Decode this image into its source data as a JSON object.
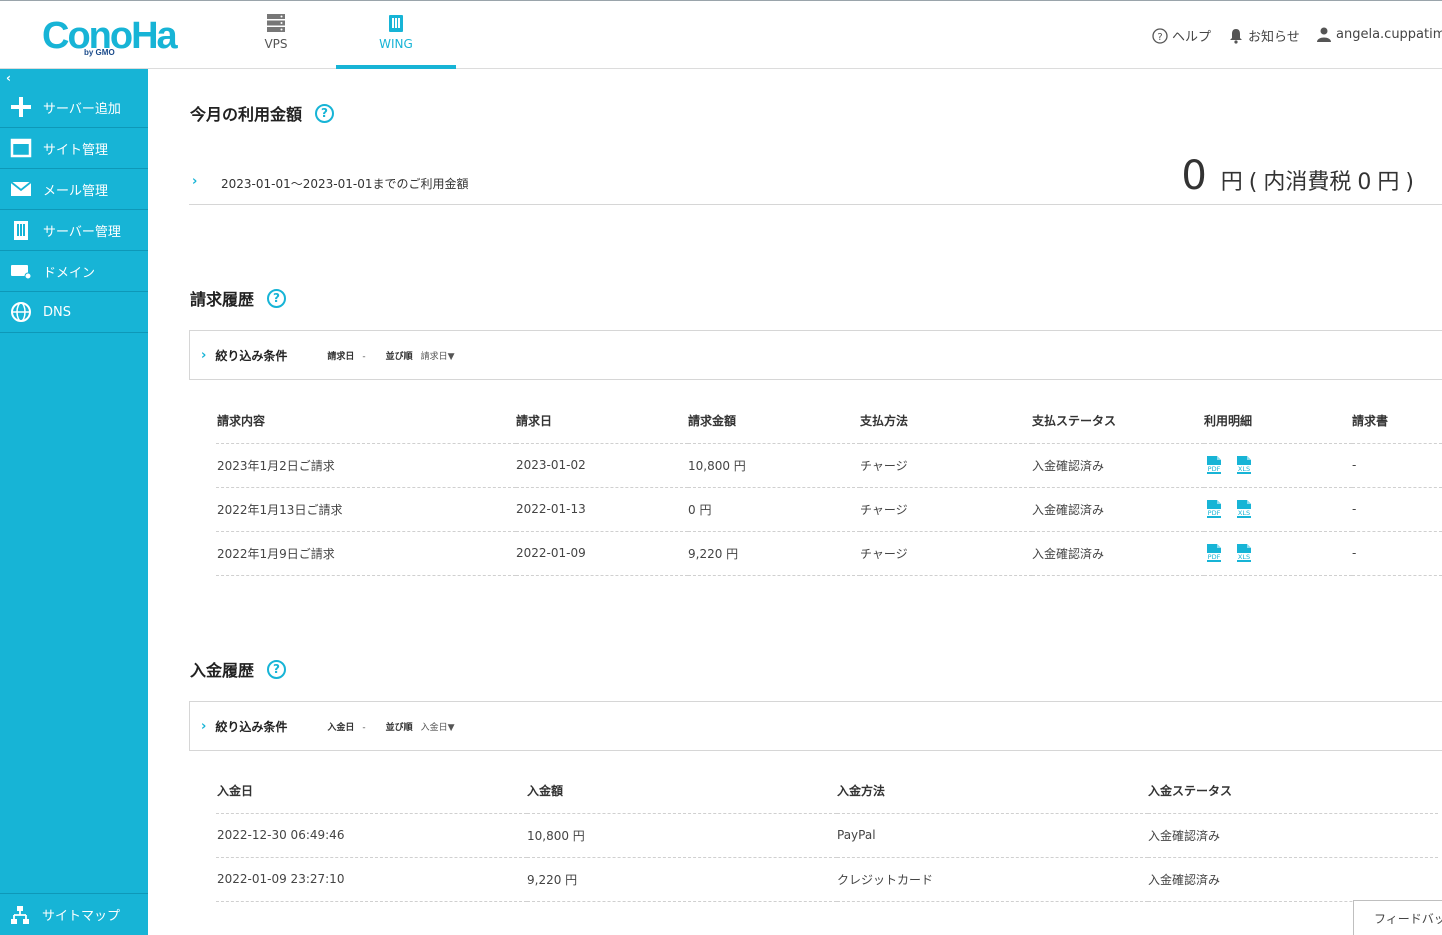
{
  "brand": {
    "logo_text": "ConoHa",
    "logo_sub": "by GMO"
  },
  "top_tabs": [
    {
      "label": "VPS",
      "icon": "server-icon"
    },
    {
      "label": "WING",
      "icon": "wing-building-icon",
      "active": true
    }
  ],
  "header_links": {
    "help": "ヘルプ",
    "notice": "お知らせ",
    "user": "angela.cuppatimes"
  },
  "sidebar": {
    "collapse_glyph": "‹",
    "items": [
      {
        "label": "サーバー追加",
        "icon": "plus-icon"
      },
      {
        "label": "サイト管理",
        "icon": "window-icon"
      },
      {
        "label": "メール管理",
        "icon": "mail-icon"
      },
      {
        "label": "サーバー管理",
        "icon": "server-building-icon"
      },
      {
        "label": "ドメイン",
        "icon": "domain-icon"
      },
      {
        "label": "DNS",
        "icon": "globe-icon"
      }
    ],
    "sitemap": "サイトマップ"
  },
  "usage": {
    "title": "今月の利用金額",
    "period_label": "2023-01-01～2023-01-01までのご利用金額",
    "amount": "0",
    "yen": "円",
    "open": "(",
    "tax_label": "内消費税",
    "tax_amount": "0",
    "close": ")"
  },
  "billing": {
    "title": "請求履歴",
    "filter": {
      "title": "絞り込み条件",
      "date_label": "請求日",
      "date_value": "-",
      "sort_label": "並び順",
      "sort_value": "請求日▼"
    },
    "columns": [
      "請求内容",
      "請求日",
      "請求金額",
      "支払方法",
      "支払ステータス",
      "利用明細",
      "請求書"
    ],
    "rows": [
      {
        "content": "2023年1月2日ご請求",
        "date": "2023-01-02",
        "amount": "10,800 円",
        "method": "チャージ",
        "status": "入金確認済み",
        "invoice": "-"
      },
      {
        "content": "2022年1月13日ご請求",
        "date": "2022-01-13",
        "amount": "0 円",
        "method": "チャージ",
        "status": "入金確認済み",
        "invoice": "-"
      },
      {
        "content": "2022年1月9日ご請求",
        "date": "2022-01-09",
        "amount": "9,220 円",
        "method": "チャージ",
        "status": "入金確認済み",
        "invoice": "-"
      }
    ],
    "pdf_label": "PDF",
    "xls_label": "XLS"
  },
  "payments": {
    "title": "入金履歴",
    "filter": {
      "title": "絞り込み条件",
      "date_label": "入金日",
      "date_value": "-",
      "sort_label": "並び順",
      "sort_value": "入金日▼"
    },
    "columns": [
      "入金日",
      "入金額",
      "入金方法",
      "入金ステータス"
    ],
    "rows": [
      {
        "date": "2022-12-30 06:49:46",
        "amount": "10,800 円",
        "method": "PayPal",
        "status": "入金確認済み"
      },
      {
        "date": "2022-01-09 23:27:10",
        "amount": "9,220 円",
        "method": "クレジットカード",
        "status": "入金確認済み"
      }
    ]
  },
  "feedback": "フィードバック",
  "colors": {
    "accent": "#17b4d6",
    "sidebar": "#17b4d6"
  }
}
